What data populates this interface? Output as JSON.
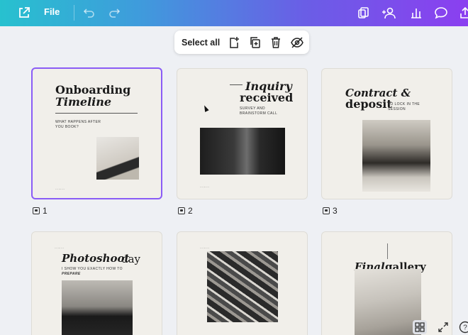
{
  "topbar": {
    "file_label": "File"
  },
  "toolbar": {
    "select_all": "Select all"
  },
  "pages": [
    {
      "number": "1",
      "title_line1": "Onboarding",
      "title_line2": "Timeline",
      "subtitle": "WHAT HAPPENS AFTER YOU BOOK?"
    },
    {
      "number": "2",
      "title_line1": "Inquiry",
      "title_line2": "received",
      "subtitle": "SURVEY AND BRAINSTORM CALL"
    },
    {
      "number": "3",
      "title_line1": "Contract &",
      "title_line2": "deposit",
      "subtitle": "TO LOCK IN THE SESSION"
    },
    {
      "number": "",
      "title_line1": "Photoshoot",
      "title_line2": "day",
      "subtitle": "I SHOW YOU EXACTLY HOW TO",
      "subtitle2": "PREPARE"
    },
    {
      "number": ""
    },
    {
      "number": "",
      "title_line1": "Final",
      "title_line2": "gallery"
    }
  ],
  "colors": {
    "selected_border": "#8a5cf6",
    "topbar_start": "#27c1cf",
    "topbar_end": "#8b3ff0"
  },
  "icons": {
    "topbar": [
      "external-share-icon",
      "undo-icon",
      "redo-icon",
      "pages-icon",
      "collaborate-icon",
      "analytics-icon",
      "comment-icon",
      "share-icon"
    ],
    "toolbar": [
      "add-page-icon",
      "duplicate-icon",
      "trash-icon",
      "hide-icon"
    ],
    "bottom": [
      "grid-view-icon",
      "fullscreen-icon",
      "help-icon"
    ]
  }
}
